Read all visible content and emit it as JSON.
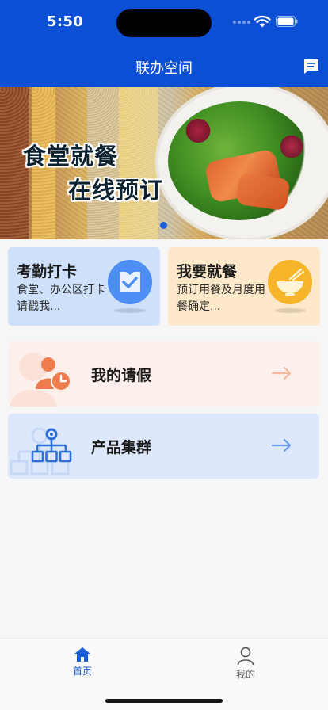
{
  "status_bar": {
    "time": "5:50"
  },
  "header": {
    "title": "联办空间",
    "message_icon": "message-icon"
  },
  "banner": {
    "line1": "食堂就餐",
    "line2": "在线预订",
    "active_slide": 1
  },
  "cards": [
    {
      "title": "考勤打卡",
      "desc": "食堂、办公区打卡请戳我...",
      "icon": "check-badge-icon"
    },
    {
      "title": "我要就餐",
      "desc": "预订用餐及月度用餐确定...",
      "icon": "rice-bowl-icon"
    }
  ],
  "rows": [
    {
      "label": "我的请假",
      "icon": "person-clock-icon",
      "arrow": "arrow-right-icon"
    },
    {
      "label": "产品集群",
      "icon": "org-chart-icon",
      "arrow": "arrow-right-icon"
    }
  ],
  "tabbar": {
    "tabs": [
      {
        "label": "首页",
        "icon": "home-icon",
        "active": true
      },
      {
        "label": "我的",
        "icon": "user-icon",
        "active": false
      }
    ]
  },
  "colors": {
    "primary": "#0a4fd4",
    "active_tab": "#1a5fd8",
    "attendance_card": "#cfe0fb",
    "meal_card": "#fde9c9",
    "leave_row": "#fdf0ec",
    "cluster_row": "#dde8fc"
  }
}
